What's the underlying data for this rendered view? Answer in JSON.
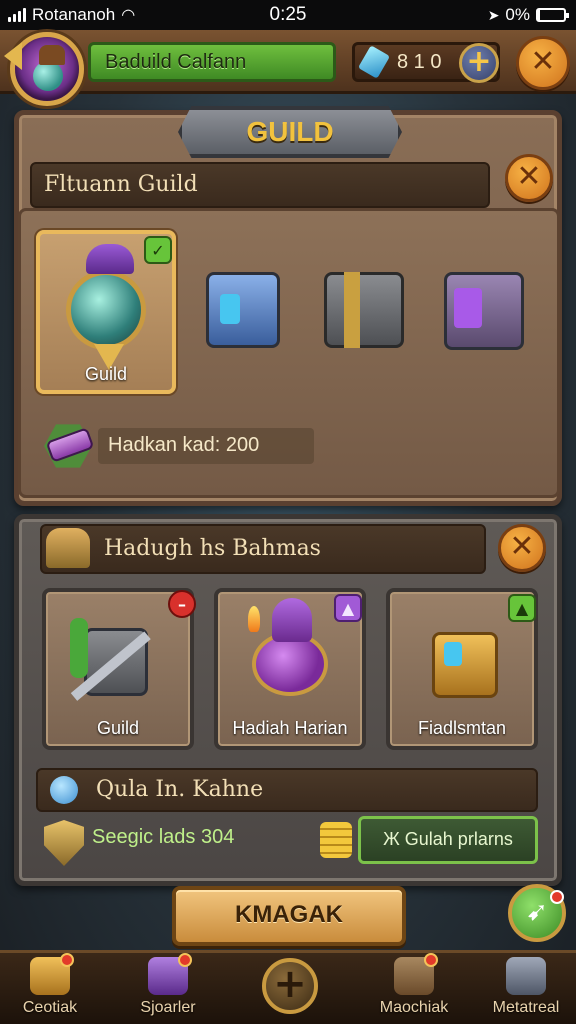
{
  "status_bar": {
    "carrier": "Rotananoh",
    "time": "0:25",
    "battery": "0%",
    "battery_level": 0.05
  },
  "top_bar": {
    "player_name": "Baduild Calfann",
    "gem_count": "8 1 0",
    "add_label": "+",
    "close_label": "✕"
  },
  "guild_panel": {
    "tab_label": "GUILD",
    "title": "Fltuann Guild",
    "close_label": "✕",
    "selected_item_label": "Guild",
    "selected_badge": "✓",
    "requirement_text": "Hadkan kad: 200"
  },
  "reward_panel": {
    "title": "Hadugh hs Bahmas",
    "close_label": "✕",
    "cards": [
      {
        "label": "Guild",
        "badge": "–"
      },
      {
        "label": "Hadiah Harian",
        "badge": "▲"
      },
      {
        "label": "Fiadlsmtan",
        "badge": "▲"
      }
    ],
    "info_text": "Qula In. Kahne",
    "stat_text": "Seegic lads 304",
    "green_button": "Ж Gulah prlarns"
  },
  "main_button": "KMAGAK",
  "fab_icon": "arrow-icon",
  "bottom_nav": {
    "items": [
      {
        "label": "Ceotiak"
      },
      {
        "label": "Sjoarler"
      },
      {
        "label": "Maochiak"
      },
      {
        "label": "Metatreal"
      }
    ],
    "center_label": "+"
  },
  "colors": {
    "accent_orange": "#f7b245",
    "name_green": "#6fbf3e",
    "gold": "#f2c23e"
  }
}
